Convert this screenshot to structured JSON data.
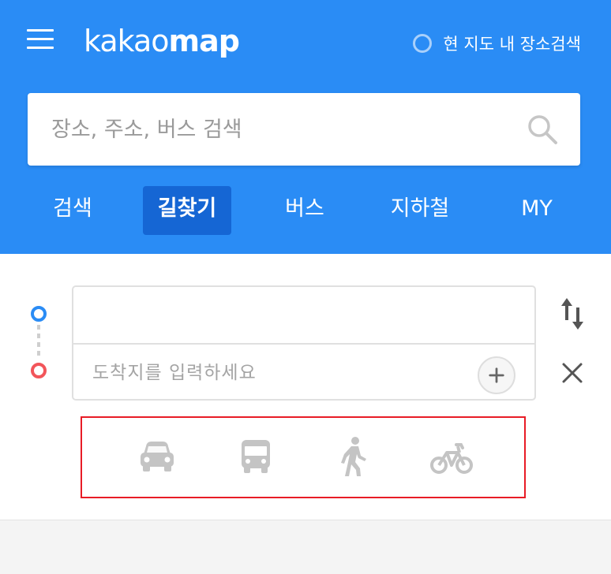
{
  "header": {
    "logo_light": "kakao",
    "logo_bold": "map",
    "nearby_search_label": "현 지도 내 장소검색"
  },
  "search": {
    "placeholder": "장소, 주소, 버스 검색"
  },
  "tabs": [
    {
      "label": "검색",
      "active": false
    },
    {
      "label": "길찾기",
      "active": true
    },
    {
      "label": "버스",
      "active": false
    },
    {
      "label": "지하철",
      "active": false
    },
    {
      "label": "MY",
      "active": false
    }
  ],
  "route": {
    "origin_value": "",
    "origin_placeholder": "",
    "destination_value": "",
    "destination_placeholder": "도착지를 입력하세요"
  },
  "transport_modes": [
    "car-icon",
    "bus-icon",
    "walk-icon",
    "bicycle-icon"
  ],
  "colors": {
    "brand_blue": "#2a8cf5",
    "active_tab": "#1566d4",
    "start_dot": "#2a8cf5",
    "end_dot": "#f2555a",
    "highlight_box": "#e81c26",
    "mode_icon": "#c4c4c4"
  }
}
